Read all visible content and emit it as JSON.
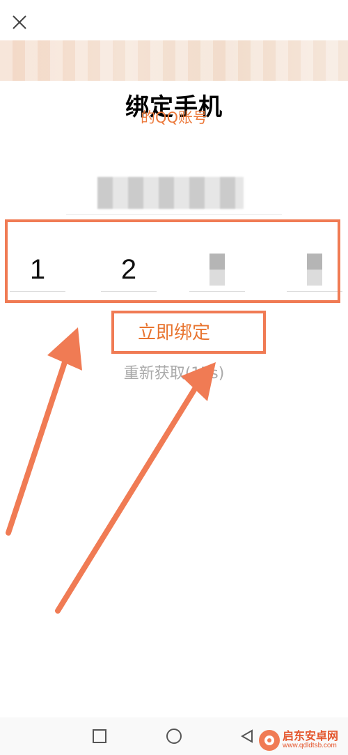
{
  "header": {
    "title": "绑定手机",
    "subtitle": "的QQ账号"
  },
  "code": {
    "digits": [
      "1",
      "2",
      "",
      ""
    ]
  },
  "actions": {
    "bind_label": "立即绑定",
    "resend_label": "重新获取(17s)"
  },
  "watermark": {
    "name": "启东安卓网",
    "url": "www.qdldtsb.com"
  },
  "colors": {
    "accent": "#ec7a3c",
    "annotation": "#f07b54",
    "muted": "#a9a9a9"
  },
  "icons": {
    "close": "close-icon",
    "nav": [
      "square-icon",
      "circle-icon",
      "triangle-back-icon"
    ]
  }
}
